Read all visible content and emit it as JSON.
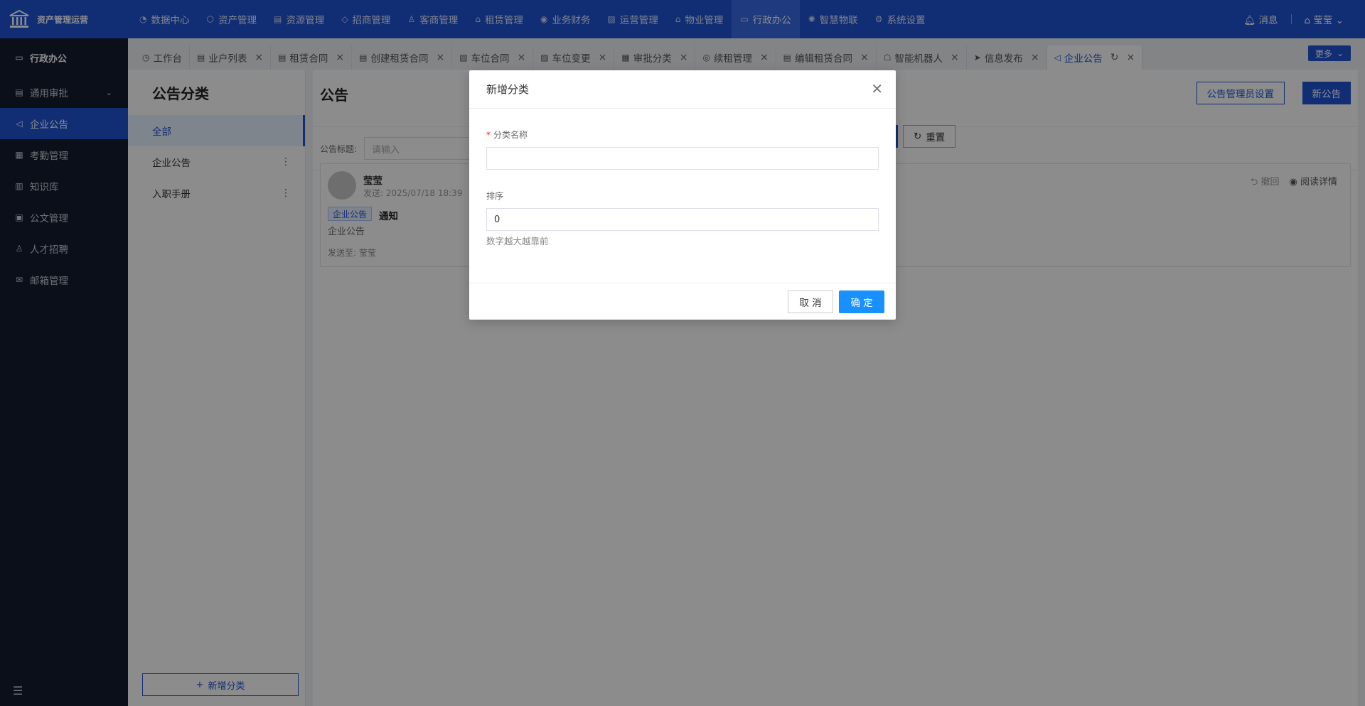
{
  "brand": {
    "name": "资产管理运营",
    "logo_icon": "bank-icon"
  },
  "topnav": [
    {
      "label": "数据中心",
      "icon": "pie-icon"
    },
    {
      "label": "资产管理",
      "icon": "box-icon"
    },
    {
      "label": "资源管理",
      "icon": "building-icon"
    },
    {
      "label": "招商管理",
      "icon": "tag-icon"
    },
    {
      "label": "客商管理",
      "icon": "user-icon"
    },
    {
      "label": "租赁管理",
      "icon": "home-icon"
    },
    {
      "label": "业务财务",
      "icon": "money-icon"
    },
    {
      "label": "运营管理",
      "icon": "chart-icon"
    },
    {
      "label": "物业管理",
      "icon": "house-icon"
    },
    {
      "label": "行政办公",
      "icon": "monitor-icon"
    },
    {
      "label": "智慧物联",
      "icon": "atom-icon"
    },
    {
      "label": "系统设置",
      "icon": "gear-icon"
    }
  ],
  "top_right": {
    "messages": "消息",
    "user": "莹莹"
  },
  "sidebar": {
    "title": "行政办公",
    "items": [
      {
        "label": "通用审批",
        "icon": "doc-icon",
        "has_chevron": true
      },
      {
        "label": "企业公告",
        "icon": "speaker-icon"
      },
      {
        "label": "考勤管理",
        "icon": "calendar-icon"
      },
      {
        "label": "知识库",
        "icon": "book-icon"
      },
      {
        "label": "公文管理",
        "icon": "file-icon"
      },
      {
        "label": "人才招聘",
        "icon": "person-icon"
      },
      {
        "label": "邮箱管理",
        "icon": "mail-icon"
      }
    ]
  },
  "tabs": [
    {
      "label": "工作台",
      "closable": false
    },
    {
      "label": "业户列表",
      "closable": true
    },
    {
      "label": "租赁合同",
      "closable": true
    },
    {
      "label": "创建租赁合同",
      "closable": true
    },
    {
      "label": "车位合同",
      "closable": true
    },
    {
      "label": "车位变更",
      "closable": true
    },
    {
      "label": "审批分类",
      "closable": true
    },
    {
      "label": "续租管理",
      "closable": true
    },
    {
      "label": "编辑租赁合同",
      "closable": true
    },
    {
      "label": "智能机器人",
      "closable": true
    },
    {
      "label": "信息发布",
      "closable": true
    },
    {
      "label": "企业公告",
      "closable": true
    }
  ],
  "more_label": "更多",
  "category_panel": {
    "title": "公告分类",
    "items": [
      "全部",
      "企业公告",
      "入职手册"
    ],
    "add_label": "新增分类"
  },
  "main": {
    "title": "公告",
    "admin_btn": "公告管理员设置",
    "new_btn": "新公告",
    "filter_label": "公告标题:",
    "filter_placeholder": "请输入",
    "reset_label": "重置",
    "card": {
      "author": "莹莹",
      "sent_time": "发送: 2025/07/18 18:39",
      "tag": "企业公告",
      "title": "通知",
      "subtitle": "企业公告",
      "sent_to": "发送至:   莹莹",
      "revoke": "撤回",
      "read_detail": "阅读详情"
    }
  },
  "dialog": {
    "title": "新增分类",
    "name_label": "分类名称",
    "name_value": "",
    "sort_label": "排序",
    "sort_value": "0",
    "sort_hint": "数字越大越靠前",
    "cancel": "取 消",
    "ok": "确 定"
  }
}
